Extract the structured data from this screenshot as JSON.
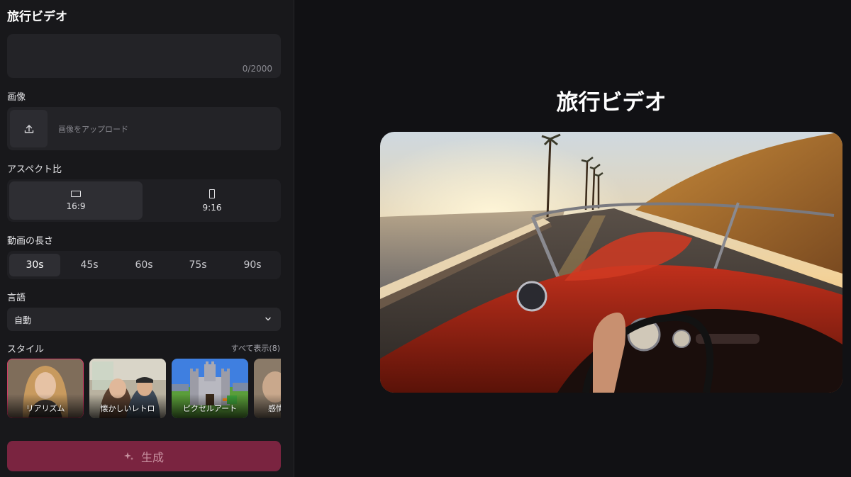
{
  "panel": {
    "title": "旅行ビデオ",
    "prompt": {
      "value": "",
      "counter": "0/2000"
    },
    "image": {
      "label": "画像",
      "upload_text": "画像をアップロード",
      "icon": "upload-icon"
    },
    "aspect": {
      "label": "アスペクト比",
      "options": [
        {
          "label": "16:9",
          "icon": "landscape-icon",
          "selected": true
        },
        {
          "label": "9:16",
          "icon": "portrait-icon",
          "selected": false
        }
      ]
    },
    "duration": {
      "label": "動画の長さ",
      "options": [
        "30s",
        "45s",
        "60s",
        "75s",
        "90s"
      ],
      "selected": "30s"
    },
    "language": {
      "label": "言語",
      "value": "自動",
      "icon": "chevron-down-icon"
    },
    "style": {
      "label": "スタイル",
      "see_all": "すべて表示(8)",
      "items": [
        {
          "label": "リアリズム",
          "selected": true
        },
        {
          "label": "懐かしいレトロ",
          "selected": false
        },
        {
          "label": "ピクセルアート",
          "selected": false
        },
        {
          "label": "感情",
          "selected": false
        }
      ]
    },
    "generate": {
      "label": "生成",
      "icon": "sparkle-icon"
    }
  },
  "preview": {
    "title": "旅行ビデオ"
  },
  "colors": {
    "accent": "#d23c66",
    "generate_button": "#7a2440",
    "panel_bg": "#18181b",
    "page_bg": "#111114"
  }
}
